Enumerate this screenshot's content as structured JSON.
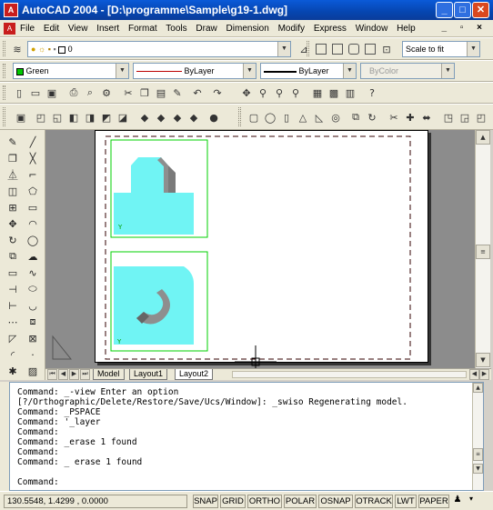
{
  "window": {
    "app_icon_label": "A",
    "title": "AutoCAD 2004 - [D:\\programme\\Sample\\g19-1.dwg]",
    "controls": [
      "_",
      "□",
      "✕"
    ]
  },
  "menubar": {
    "items": [
      "File",
      "Edit",
      "View",
      "Insert",
      "Format",
      "Tools",
      "Draw",
      "Dimension",
      "Modify",
      "Express",
      "Window",
      "Help"
    ],
    "doc_controls": "_ ▫ ×"
  },
  "layers_toolbar": {
    "layer_value": "0",
    "scale_value": "Scale to fit"
  },
  "properties_toolbar": {
    "color_value": "Green",
    "linetype_value": "ByLayer",
    "lineweight_value": "ByLayer",
    "plotstyle_value": "ByColor"
  },
  "layout_tabs": [
    "Model",
    "Layout1",
    "Layout2"
  ],
  "layout_tabs_active": 2,
  "ucs_label": "Y",
  "command_window": {
    "lines": [
      "Command: _-view Enter an option",
      "[?/Orthographic/Delete/Restore/Save/Ucs/Window]: _swiso Regenerating model.",
      "Command: _PSPACE",
      "Command: '_layer",
      "Command:",
      "Command: _erase 1 found",
      "Command:",
      "Command: _ erase 1 found",
      "",
      "Command:"
    ]
  },
  "statusbar": {
    "coordinates": "130.5548, 1.4299 , 0.0000",
    "toggles": [
      "SNAP",
      "GRID",
      "ORTHO",
      "POLAR",
      "OSNAP",
      "OTRACK",
      "LWT",
      "PAPER"
    ]
  },
  "colors": {
    "viewport_border": "#00d000",
    "model_fill": "#70f4f4",
    "model_shadow": "#8e8e8e",
    "titlebar": "#0a5ad8"
  }
}
